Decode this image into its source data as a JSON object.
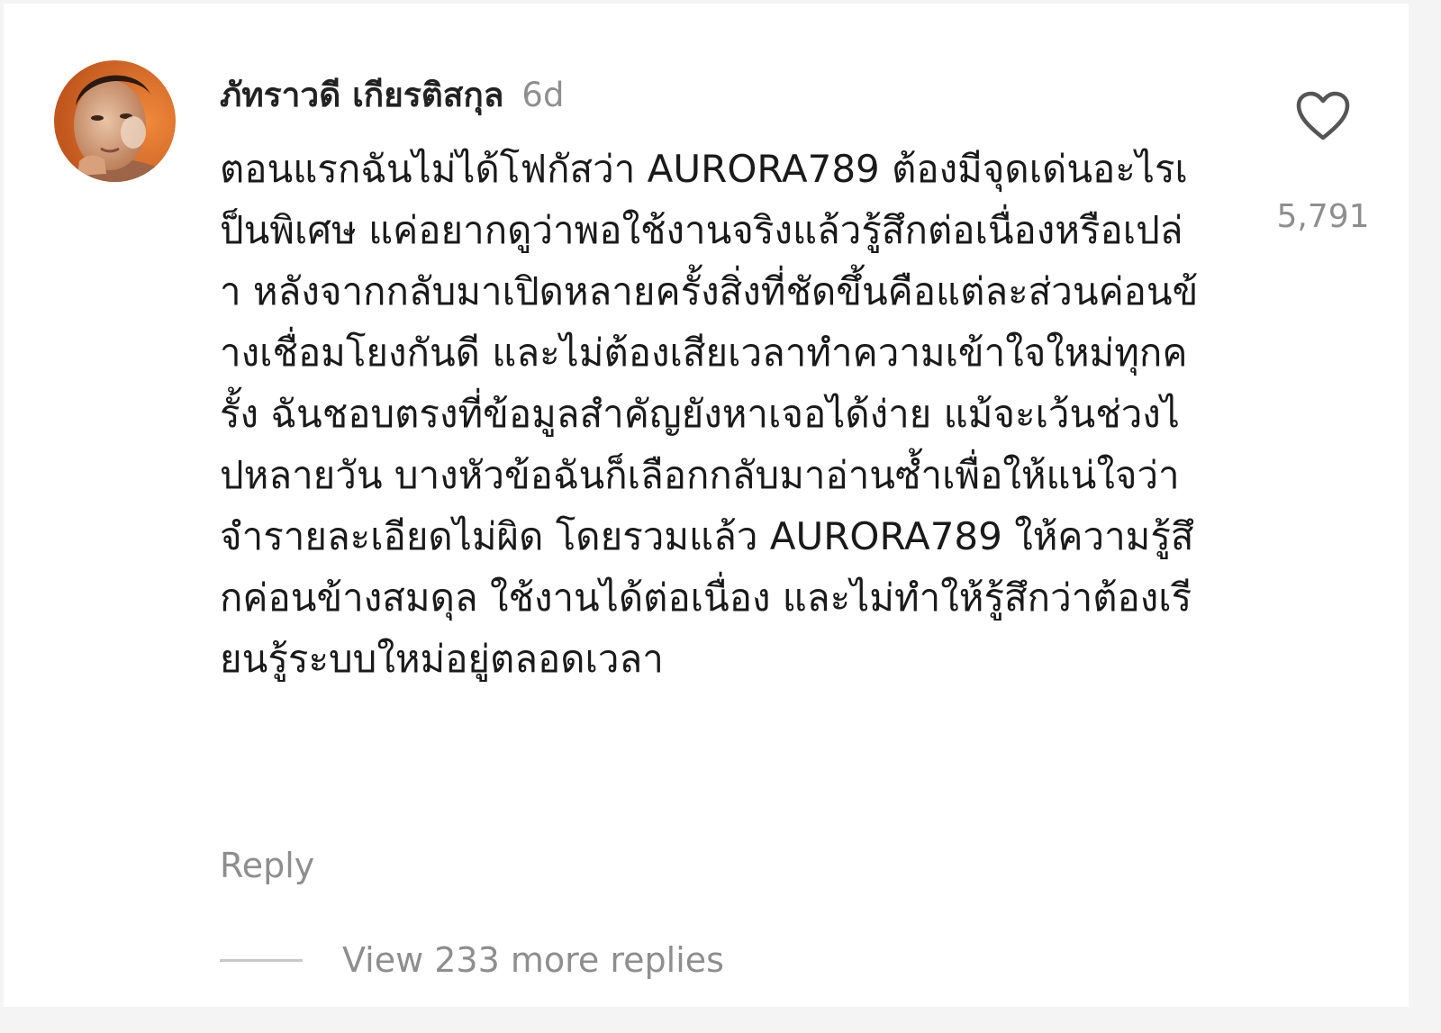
{
  "comment": {
    "author": "ภัทราวดี เกียรติสกุล",
    "time": "6d",
    "text": "ตอนแรกฉันไม่ได้โฟกัสว่า AURORA789 ต้องมีจุดเด่นอะไรเป็นพิเศษ แค่อยากดูว่าพอใช้งานจริงแล้วรู้สึกต่อเนื่องหรือเปล่า หลังจากกลับมาเปิดหลายครั้งสิ่งที่ชัดขึ้นคือแต่ละส่วนค่อนข้างเชื่อมโยงกันดี และไม่ต้องเสียเวลาทำความเข้าใจใหม่ทุกครั้ง ฉันชอบตรงที่ข้อมูลสำคัญยังหาเจอได้ง่าย แม้จะเว้นช่วงไปหลายวัน บางหัวข้อฉันก็เลือกกลับมาอ่านซ้ำเพื่อให้แน่ใจว่าจำรายละเอียดไม่ผิด โดยรวมแล้ว AURORA789 ให้ความรู้สึกค่อนข้างสมดุล ใช้งานได้ต่อเนื่อง และไม่ทำให้รู้สึกว่าต้องเรียนรู้ระบบใหม่อยู่ตลอดเวลา",
    "like_icon": "heart-outline-icon",
    "like_count": "5,791",
    "reply_label": "Reply",
    "view_replies_label": "View 233 more replies"
  },
  "colors": {
    "background": "#ffffff",
    "text_primary": "#1a1a1a",
    "text_secondary": "#8e8e8e"
  }
}
